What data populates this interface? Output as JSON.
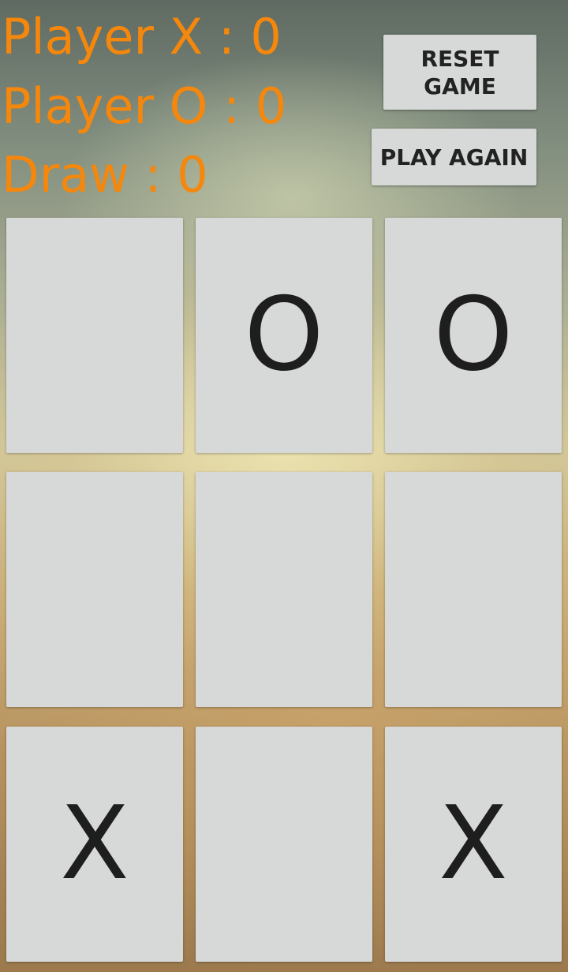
{
  "scores": {
    "player_x": "Player X : 0",
    "player_o": "Player O : 0",
    "draw": "Draw : 0"
  },
  "buttons": {
    "reset": "RESET GAME",
    "play_again": "PLAY AGAIN"
  },
  "board": [
    [
      "",
      "O",
      "O"
    ],
    [
      "",
      "",
      ""
    ],
    [
      "X",
      "",
      "X"
    ]
  ],
  "colors": {
    "score_text": "#f5870c",
    "cell_bg": "#d7d9d9",
    "mark": "#1e1e1e"
  }
}
